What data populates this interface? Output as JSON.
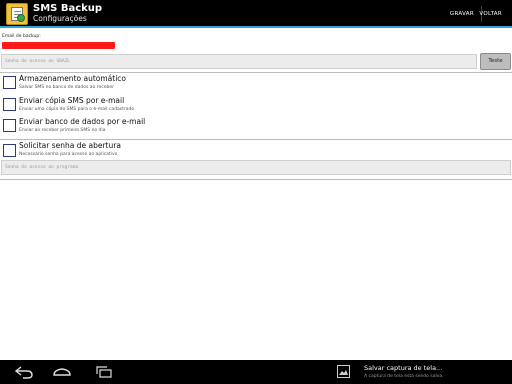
{
  "action_bar": {
    "title": "SMS Backup",
    "subtitle": "Configurações",
    "buttons": [
      "GRAVAR",
      "VOLTAR"
    ],
    "accent_color": "#2ea3d8"
  },
  "email": {
    "label": "Email de backup:",
    "value_redacted": true,
    "redaction_color": "#ff1a1a"
  },
  "password_field": {
    "placeholder": "Senha de acesso ao GBAZL",
    "test_button": "Teste"
  },
  "preferences": [
    {
      "title": "Armazenamento automático",
      "summary": "Salvar SMS no banco de dados ao receber",
      "checked": false
    },
    {
      "title": "Enviar cópia SMS por e-mail",
      "summary": "Enviar uma cópia do SMS para o e-mail cadastrado",
      "checked": false
    },
    {
      "title": "Enviar banco de dados por e-mail",
      "summary": "Enviar ao receber primeiro SMS no dia",
      "checked": false
    },
    {
      "title": "Solicitar senha de abertura",
      "summary": "Necessário senha para acesso ao aplicativo",
      "checked": false
    }
  ],
  "app_password_field": {
    "placeholder": "Senha de acesso ao programa"
  },
  "system_bar": {
    "nav_icons": [
      "back-icon",
      "home-icon",
      "recent-apps-icon"
    ],
    "notification": {
      "icon": "screenshot-icon",
      "title": "Salvar captura de tela...",
      "text": "A captura de tela está sendo salva."
    }
  }
}
